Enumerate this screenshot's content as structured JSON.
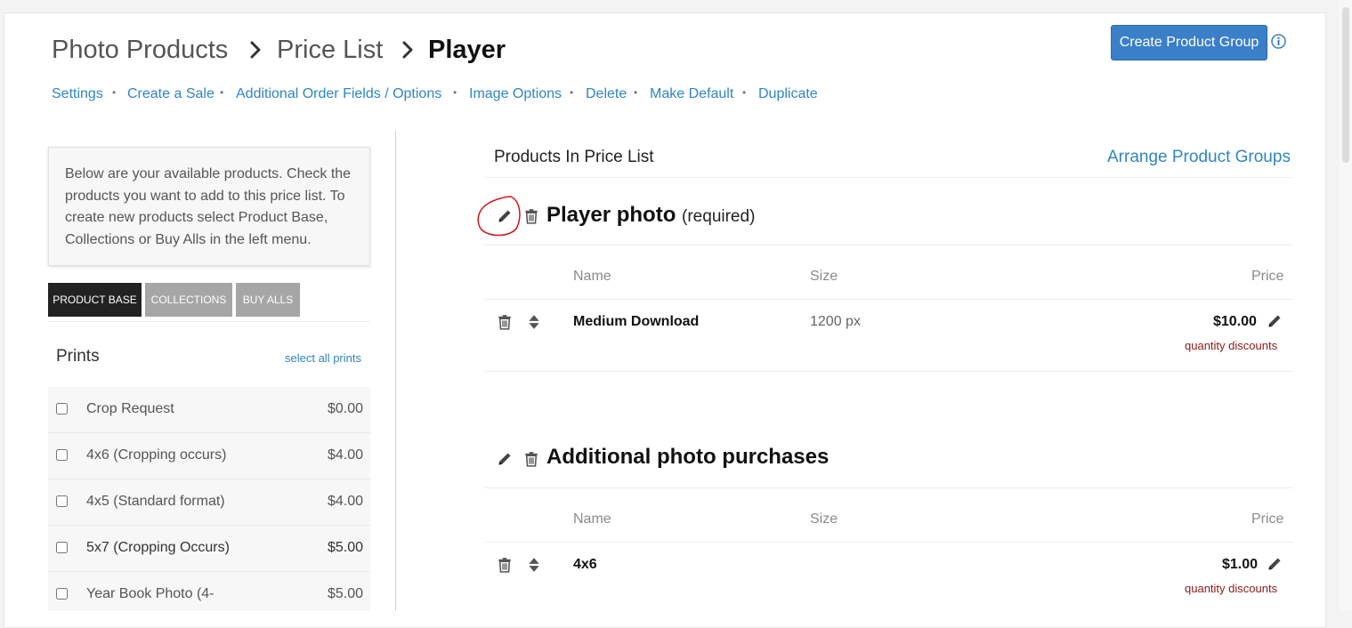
{
  "breadcrumb": {
    "items": [
      "Photo Products",
      "Price List"
    ],
    "current": "Player"
  },
  "header": {
    "create_group_label": "Create Product Group"
  },
  "nav_links": [
    "Settings",
    "Create a Sale",
    "Additional Order Fields / Options",
    "Image Options",
    "Delete",
    "Make Default",
    "Duplicate"
  ],
  "nav_separator": "•",
  "help_text": "Below are your available products. Check the products you want to add to this price list. To create new products select Product Base, Collections or Buy Alls in the left menu.",
  "tabs": [
    {
      "label": "PRODUCT BASE",
      "active": true
    },
    {
      "label": "COLLECTIONS",
      "active": false
    },
    {
      "label": "BUY ALLS",
      "active": false
    }
  ],
  "prints": {
    "title": "Prints",
    "select_all_label": "select all prints",
    "items": [
      {
        "name": "Crop Request",
        "price": "$0.00",
        "checked": false
      },
      {
        "name": "4x6 (Cropping occurs)",
        "price": "$4.00",
        "checked": false
      },
      {
        "name": "4x5 (Standard format)",
        "price": "$4.00",
        "checked": false
      },
      {
        "name": "5x7 (Cropping Occurs)",
        "price": "$5.00",
        "checked": false
      },
      {
        "name": "Year Book Photo (4-",
        "price": "$5.00",
        "checked": false
      }
    ]
  },
  "price_list": {
    "title": "Products In Price List",
    "arrange_label": "Arrange Product Groups",
    "columns": {
      "name": "Name",
      "size": "Size",
      "price": "Price"
    },
    "groups": [
      {
        "title": "Player photo",
        "note": "(required)",
        "items": [
          {
            "name": "Medium Download",
            "size": "1200 px",
            "price": "$10.00",
            "discount_label": "quantity discounts"
          }
        ]
      },
      {
        "title": "Additional photo purchases",
        "note": "",
        "items": [
          {
            "name": "4x6",
            "size": "",
            "price": "$1.00",
            "discount_label": "quantity discounts"
          }
        ]
      }
    ]
  },
  "icons": {
    "breadcrumb_separator": "chevron-right-icon",
    "info": "info-icon",
    "edit": "pencil-icon",
    "delete": "trash-icon",
    "reorder": "sort-arrows-icon"
  },
  "colors": {
    "link": "#2f86c0",
    "primary_button": "#3a7fc8",
    "active_tab": "#222222",
    "inactive_tab": "#a6a6a6",
    "discount_link": "#8b1a1a",
    "annotation_circle": "#d0141a"
  }
}
